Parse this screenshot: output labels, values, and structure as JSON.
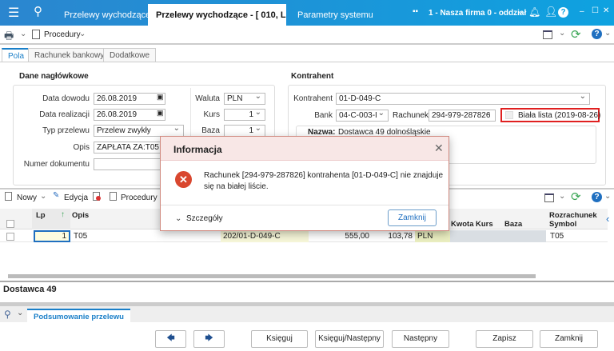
{
  "topbar": {
    "tabs": [
      "Przelewy wychodzące",
      "Przelewy wychodzące - [ 010, LK01,",
      "Parametry systemu"
    ],
    "company": "1 - Nasza firma 0 - oddział",
    "accent": "#0ea2e0"
  },
  "toolbar": {
    "procedures": "Procedury"
  },
  "tabs": [
    "Pola",
    "Rachunek bankowy",
    "Dodatkowe"
  ],
  "header_section": {
    "title": "Dane nagłówkowe",
    "data_dowodu_label": "Data dowodu",
    "data_dowodu": "26.08.2019",
    "data_realizacji_label": "Data realizacji",
    "data_realizacji": "26.08.2019",
    "typ_label": "Typ przelewu",
    "typ": "Przelew zwykły",
    "opis_label": "Opis",
    "opis": "ZAPŁATA ZA:T05",
    "numer_label": "Numer dokumentu",
    "numer": "",
    "waluta_label": "Waluta",
    "waluta": "PLN",
    "kurs_label": "Kurs",
    "kurs": "1",
    "baza_label": "Baza",
    "baza": "1"
  },
  "kontrahent": {
    "title": "Kontrahent",
    "kontrahent_label": "Kontrahent",
    "kontrahent": "01-D-049-C",
    "bank_label": "Bank",
    "bank": "04-C-003-I",
    "rachunek_label": "Rachunek",
    "rachunek": "294-979-287826",
    "biala_lista": "Biała lista (2019-08-26)",
    "nazwa_label": "Nazwa:",
    "nazwa": "Dostawca 49 dolnośląskie"
  },
  "dialog": {
    "title": "Informacja",
    "message_line1": "Rachunek [294-979-287826] kontrahenta [01-D-049-C] nie znajduje",
    "message_line2": "się na białej liście.",
    "details": "Szczegóły",
    "close": "Zamknij"
  },
  "grid_toolbar": {
    "new": "Nowy",
    "edit": "Edycja",
    "procedures": "Procedury"
  },
  "grid": {
    "columns": {
      "lp": "Lp",
      "opis": "Opis",
      "kwota": "Kwota",
      "kurs": "Kurs",
      "baza": "Baza",
      "rozrachunek": "Rozrachunek",
      "symbol": "Symbol"
    },
    "rows": [
      {
        "lp": "1",
        "opis": "T05",
        "dokument": "202/01-D-049-C",
        "kwota1": "555,00",
        "kwota2": "103,78",
        "waluta": "PLN",
        "symbol": "T05"
      }
    ]
  },
  "detail_name": "Dostawca 49",
  "bottom_tab": "Podsumowanie przelewu",
  "buttons": {
    "post": "Księguj",
    "post_next": "Księguj/Następny",
    "next": "Następny",
    "save": "Zapisz",
    "close": "Zamknij"
  }
}
